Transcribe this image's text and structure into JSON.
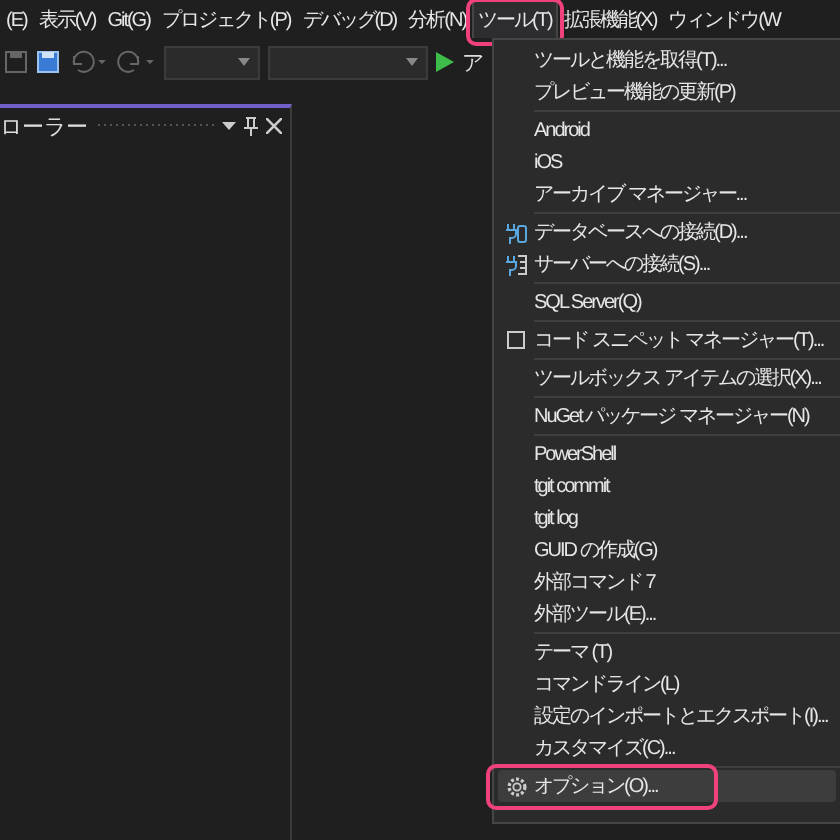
{
  "menubar": [
    {
      "label": "(E)",
      "selected": false
    },
    {
      "label": "表示(V)",
      "selected": false
    },
    {
      "label": "Git(G)",
      "selected": false
    },
    {
      "label": "プロジェクト(P)",
      "selected": false
    },
    {
      "label": "デバッグ(D)",
      "selected": false
    },
    {
      "label": "分析(N)",
      "selected": false
    },
    {
      "label": "ツール(T)",
      "selected": true
    },
    {
      "label": "拡張機能(X)",
      "selected": false
    },
    {
      "label": "ウィンドウ(W",
      "selected": false
    }
  ],
  "toolbar": {
    "start_label": "ア"
  },
  "panel": {
    "title": "ローラー"
  },
  "dropdown": {
    "groups": [
      [
        {
          "label": "ツールと機能を取得(T)...",
          "selected": false
        },
        {
          "label": "プレビュー機能の更新(P)",
          "selected": false
        }
      ],
      [
        {
          "label": "Android",
          "selected": false
        },
        {
          "label": "iOS",
          "selected": false
        },
        {
          "label": "アーカイブ マネージャー...",
          "selected": false
        }
      ],
      [
        {
          "label": "データベースへの接続(D)...",
          "kind": "database",
          "selected": false
        },
        {
          "label": "サーバーへの接続(S)...",
          "kind": "server",
          "selected": false
        }
      ],
      [
        {
          "label": "SQL Server(Q)",
          "selected": false
        }
      ],
      [
        {
          "label": "コード スニペット マネージャー(T)...",
          "kind": "snippet",
          "selected": false
        }
      ],
      [
        {
          "label": "ツールボックス アイテムの選択(X)...",
          "selected": false
        }
      ],
      [
        {
          "label": "NuGet パッケージ マネージャー(N)",
          "selected": false
        }
      ],
      [
        {
          "label": "PowerShell",
          "selected": false
        },
        {
          "label": "tgit commit",
          "selected": false
        },
        {
          "label": "tgit log",
          "selected": false
        },
        {
          "label": "GUID の作成(G)",
          "selected": false
        },
        {
          "label": "外部コマンド 7",
          "selected": false
        },
        {
          "label": "外部ツール(E)...",
          "selected": false
        }
      ],
      [
        {
          "label": "テーマ (T)",
          "selected": false
        },
        {
          "label": "コマンドライン(L)",
          "selected": false
        },
        {
          "label": "設定のインポートとエクスポート(I)...",
          "selected": false
        },
        {
          "label": "カスタマイズ(C)...",
          "selected": false
        }
      ],
      [
        {
          "label": "オプション(O)...",
          "kind": "options",
          "selected": true
        }
      ]
    ]
  }
}
